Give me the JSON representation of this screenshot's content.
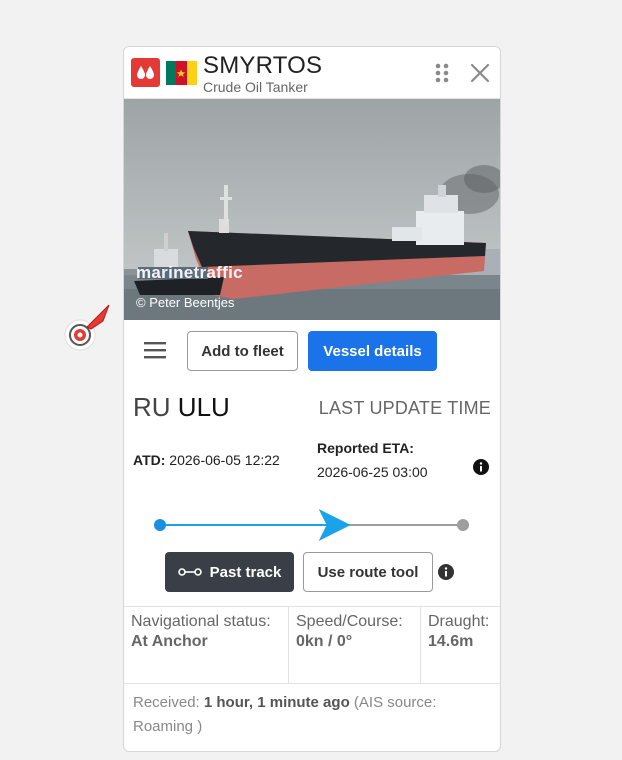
{
  "vessel": {
    "name": "SMYRTOS",
    "type": "Crude Oil Tanker",
    "type_icon": "oil-drop-icon",
    "flag": "Cameroon",
    "flag_colors": [
      "#007a5e",
      "#ce1126",
      "#fcd116"
    ],
    "accent_color": "#e53935"
  },
  "photo": {
    "watermark": "marinetraffic",
    "credit": "© Peter Beentjes"
  },
  "actions": {
    "add_to_fleet": "Add to fleet",
    "vessel_details": "Vessel details"
  },
  "route": {
    "port_country": "RU",
    "port_name": "ULU",
    "last_update_label": "LAST UPDATE TIME",
    "atd_label": "ATD:",
    "atd_value": "2026-06-05 12:22",
    "eta_label": "Reported ETA:",
    "eta_value": "2026-06-25 03:00",
    "progress_fraction": 0.55
  },
  "track": {
    "past_track": "Past track",
    "use_route_tool": "Use route tool"
  },
  "stats": {
    "nav_status_label": "Navigational status:",
    "nav_status_value": "At Anchor",
    "speed_label": "Speed/Course:",
    "speed_value": "0kn / 0°",
    "draught_label": "Draught:",
    "draught_value": "14.6m"
  },
  "received": {
    "label": "Received:",
    "value": "1 hour, 1 minute ago",
    "source": "(AIS source: Roaming )"
  },
  "colors": {
    "primary": "#1a73e8",
    "dark_button": "#3a3f47",
    "progress_line": "#1aa3e8"
  }
}
